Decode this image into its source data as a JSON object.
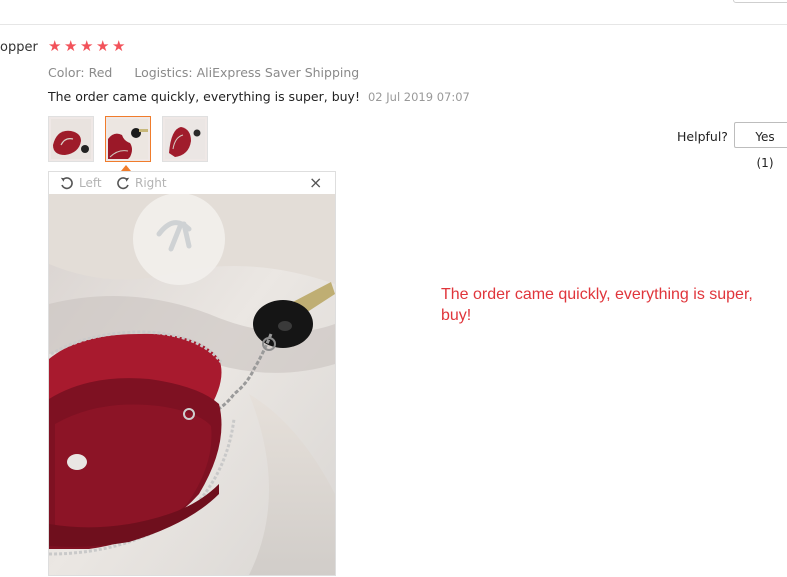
{
  "reviewer": {
    "name": "opper"
  },
  "rating": {
    "stars": 5,
    "max": 5,
    "color": "#f2525a"
  },
  "meta": {
    "color": "Color: Red",
    "logistics": "Logistics: AliExpress Saver Shipping"
  },
  "review": {
    "text": "The order came quickly, everything is super, buy!",
    "date": "02 Jul 2019 07:07"
  },
  "thumbnails": [
    {
      "name": "photo-1",
      "selected": false
    },
    {
      "name": "photo-2",
      "selected": true
    },
    {
      "name": "photo-3",
      "selected": false
    }
  ],
  "helpful": {
    "label": "Helpful?",
    "yes": "Yes (1)"
  },
  "viewer": {
    "rotate_left": "Left",
    "rotate_right": "Right",
    "close": "×"
  },
  "caption": "The order came quickly, everything is super, buy!",
  "icons": {
    "rotate_left": "rotate-left-icon",
    "rotate_right": "rotate-right-icon",
    "close": "close-icon",
    "star": "star-icon"
  },
  "colors": {
    "accent": "#f07c2c",
    "caption": "#e0353b"
  }
}
